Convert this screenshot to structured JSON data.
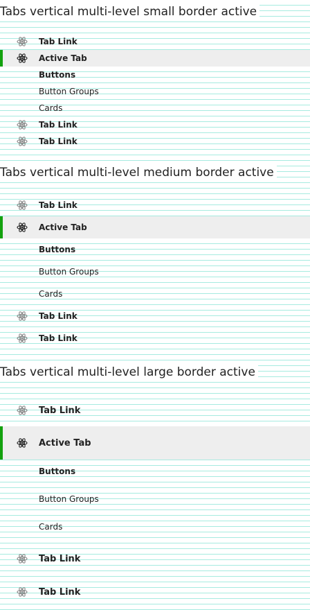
{
  "sections": [
    {
      "title": "Tabs vertical multi-level small border active",
      "items": [
        {
          "label": "Tab Link",
          "icon": "atom-icon"
        },
        {
          "label": "Active Tab",
          "icon": "atom-icon"
        },
        {
          "label": "Buttons"
        },
        {
          "label": "Button Groups"
        },
        {
          "label": "Cards"
        },
        {
          "label": "Tab Link",
          "icon": "atom-icon"
        },
        {
          "label": "Tab Link",
          "icon": "atom-icon"
        }
      ]
    },
    {
      "title": "Tabs vertical multi-level medium border active",
      "items": [
        {
          "label": "Tab Link",
          "icon": "atom-icon"
        },
        {
          "label": "Active Tab",
          "icon": "atom-icon"
        },
        {
          "label": "Buttons"
        },
        {
          "label": "Button Groups"
        },
        {
          "label": "Cards"
        },
        {
          "label": "Tab Link",
          "icon": "atom-icon"
        },
        {
          "label": "Tab Link",
          "icon": "atom-icon"
        }
      ]
    },
    {
      "title": "Tabs vertical multi-level large border active",
      "items": [
        {
          "label": "Tab Link",
          "icon": "atom-icon"
        },
        {
          "label": "Active Tab",
          "icon": "atom-icon"
        },
        {
          "label": "Buttons"
        },
        {
          "label": "Button Groups"
        },
        {
          "label": "Cards"
        },
        {
          "label": "Tab Link",
          "icon": "atom-icon"
        },
        {
          "label": "Tab Link",
          "icon": "atom-icon"
        }
      ]
    }
  ],
  "colors": {
    "active_border": "#13a10e",
    "active_background": "#eeeeee",
    "baseline_grid": "#a6ebe0"
  }
}
